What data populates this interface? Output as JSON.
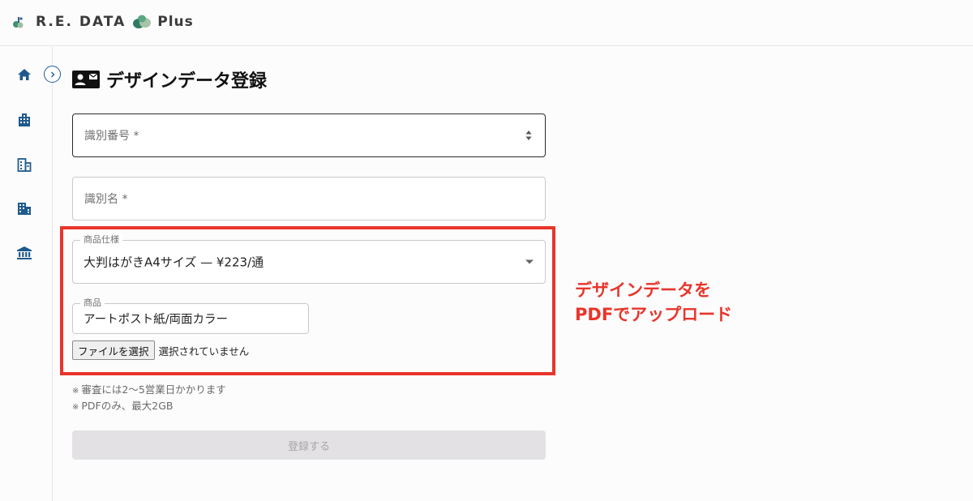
{
  "header": {
    "logo_text": "R.E. DATA",
    "logo_plus": "Plus"
  },
  "sidebar": {
    "items": [
      {
        "icon": "home-icon"
      },
      {
        "icon": "building-icon"
      },
      {
        "icon": "office-icon"
      },
      {
        "icon": "city-icon"
      },
      {
        "icon": "bank-icon"
      }
    ],
    "toggle_icon": "chevron-right-icon"
  },
  "page": {
    "title": "デザインデータ登録",
    "title_icon": "contact-card-icon"
  },
  "form": {
    "id_number_placeholder": "識別番号 *",
    "id_name_placeholder": "識別名 *",
    "spec_label": "商品仕様",
    "spec_value": "大判はがきA4サイズ — ¥223/通",
    "product_label": "商品",
    "product_value": "アートポスト紙/両面カラー",
    "file_button": "ファイルを選択",
    "file_status": "選択されていません",
    "note1": "審査には2〜5営業日かかります",
    "note2": "PDFのみ、最大2GB",
    "note_mark": "※",
    "submit_label": "登録する"
  },
  "annotation": {
    "line1": "デザインデータを",
    "line2": "PDFでアップロード",
    "color": "#e8352b"
  }
}
